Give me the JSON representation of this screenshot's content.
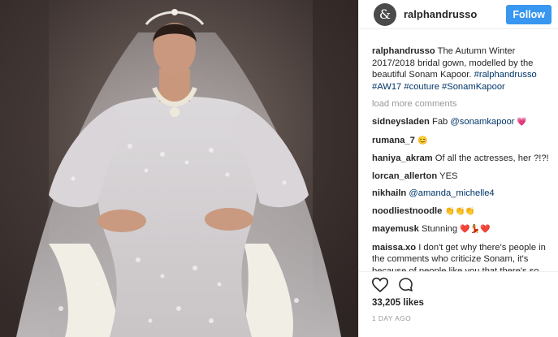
{
  "post": {
    "username": "ralphandrusso",
    "avatar_glyph": "&",
    "follow_label": "Follow",
    "caption_user": "ralphandrusso",
    "caption_text": " The Autumn Winter 2017/2018 bridal gown, modelled by the beautiful Sonam Kapoor. ",
    "caption_tags": "#ralphandrusso #AW17 #couture #SonamKapoor",
    "load_more": "load more comments",
    "likes": "33,205 likes",
    "time": "1 DAY AGO"
  },
  "comments": [
    {
      "user": "sidneysladen",
      "text": " Fab ",
      "mention": "@sonamkapoor",
      "emoji": " 💗"
    },
    {
      "user": "rumana_7",
      "text": " ",
      "emoji": "😊"
    },
    {
      "user": "haniya_akram",
      "text": " Of all the actresses, her ?!?!"
    },
    {
      "user": "lorcan_allerton",
      "text": " YES"
    },
    {
      "user": "nikhailn",
      "text": " ",
      "mention": "@amanda_michelle4"
    },
    {
      "user": "noodliestnoodle",
      "text": " ",
      "emoji": "👏👏👏"
    },
    {
      "user": "mayemusk",
      "text": " Stunning ",
      "emoji": "❤️💃❤️"
    },
    {
      "user": "maissa.xo",
      "text": " I don't get why there's people in the comments who criticize Sonam, it's because of people like you that there's so much hate in this world, y'all here talking shit about her but I'd love to see you walk at the"
    }
  ],
  "colors": {
    "follow_button": "#3897f0",
    "link": "#003569",
    "muted": "#999999"
  },
  "icons": {
    "like": "heart-icon",
    "comment": "speech-bubble-icon"
  }
}
